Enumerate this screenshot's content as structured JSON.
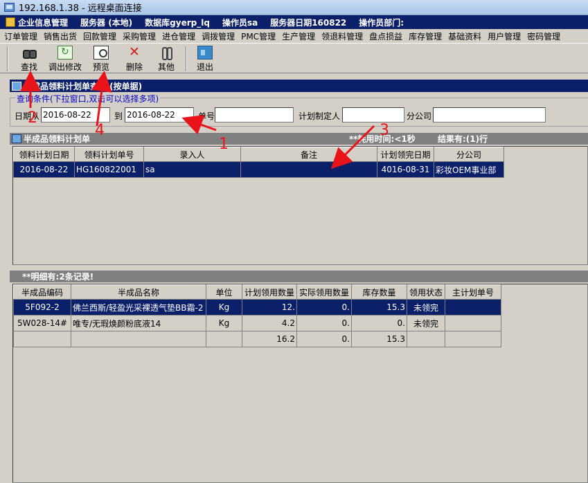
{
  "window": {
    "title": "192.168.1.38 - 远程桌面连接"
  },
  "info_bar": {
    "app_name": "企业信息管理",
    "server": "服务器 (本地)",
    "database": "数据库gyerp_lq",
    "operator": "操作员sa",
    "server_date": "服务器日期160822",
    "operator_dept": "操作员部门:"
  },
  "menu": [
    "订单管理",
    "销售出货",
    "回款管理",
    "采购管理",
    "进仓管理",
    "调拨管理",
    "PMC管理",
    "生产管理",
    "领退料管理",
    "盘点损益",
    "库存管理",
    "基础资料",
    "用户管理",
    "密码管理"
  ],
  "toolbar": {
    "find": "查找",
    "modify": "调出修改",
    "preview": "预览",
    "delete": "删除",
    "other": "其他",
    "exit": "退出"
  },
  "query": {
    "title": "半成品领料计划单查询 (按单据)",
    "group_label": "查询条件(下拉窗口,双击可以选择多项)",
    "date_label": "日期从",
    "date_from": "2016-08-22",
    "to_label": "到",
    "date_to": "2016-08-22",
    "doc_no_label": "单号",
    "doc_no": "",
    "planner_label": "计划制定人",
    "planner": "",
    "branch_label": "分公司",
    "branch": ""
  },
  "plan_panel": {
    "title": "半成品领料计划单",
    "elapsed": "**耗用时间:<1秒",
    "result": "结果有:(1)行",
    "columns": [
      "领料计划日期",
      "领料计划单号",
      "录入人",
      "备注",
      "计划领完日期",
      "分公司"
    ],
    "rows": [
      [
        "2016-08-22",
        "HG160822001",
        "sa",
        "",
        "4016-08-31",
        "彩妆OEM事业部"
      ]
    ]
  },
  "detail_panel": {
    "title": "**明细有:2条记录!",
    "columns": [
      "半成品编码",
      "半成品名称",
      "单位",
      "计划领用数量",
      "实际领用数量",
      "库存数量",
      "领用状态",
      "主计划单号"
    ],
    "rows": [
      [
        "5F092-2",
        "佛兰西斯/轻盈光采裸透气垫BB霜-2",
        "Kg",
        "12.",
        "0.",
        "15.3",
        "未领完",
        ""
      ],
      [
        "5W028-14#",
        "唯专/无瑕焕颜粉底液14",
        "Kg",
        "4.2",
        "0.",
        "0.",
        "未领完",
        ""
      ]
    ],
    "totals": [
      "",
      "",
      "",
      "16.2",
      "0.",
      "15.3",
      "",
      ""
    ]
  },
  "annotations": [
    "1",
    "2",
    "3",
    "4"
  ],
  "colors": {
    "selection": "#0b2068",
    "annotation": "#e8141a",
    "face": "#d4d0c8"
  }
}
